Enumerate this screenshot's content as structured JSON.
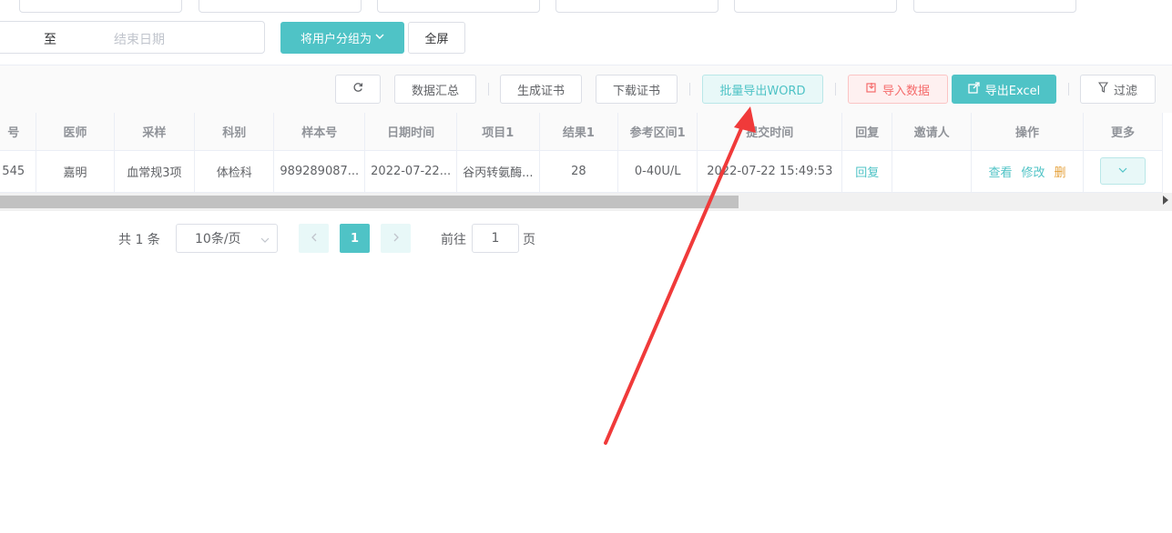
{
  "filters": {
    "date_sep": "至",
    "end_date_placeholder": "结束日期",
    "group_button": "将用户分组为",
    "fullscreen_button": "全屏"
  },
  "toolbar": {
    "summary": "数据汇总",
    "gen_cert": "生成证书",
    "download_cert": "下载证书",
    "export_word": "批量导出WORD",
    "import_data": "导入数据",
    "export_excel": "导出Excel",
    "filter": "过滤"
  },
  "table": {
    "headers": [
      "号",
      "医师",
      "采样",
      "科别",
      "样本号",
      "日期时间",
      "项目1",
      "结果1",
      "参考区间1",
      "提交时间",
      "回复",
      "邀请人",
      "操作",
      "更多"
    ],
    "rows": [
      {
        "id": "545",
        "doctor": "嘉明",
        "sample": "血常规3项",
        "dept": "体检科",
        "sample_no": "989289087...",
        "datetime": "2022-07-22...",
        "item1": "谷丙转氨酶...",
        "result1": "28",
        "ref1": "0-40U/L",
        "submit_time": "2022-07-22 15:49:53",
        "reply": "回复",
        "inviter": "",
        "op_view": "查看",
        "op_edit": "修改",
        "op_delete": "删"
      }
    ]
  },
  "pager": {
    "total": "共 1 条",
    "page_size": "10条/页",
    "current_page": "1",
    "goto_label": "前往",
    "goto_value": "1",
    "goto_suffix": "页"
  },
  "colors": {
    "accent": "#4fc3c6",
    "danger": "#f56c6c",
    "warning": "#e6a23c",
    "annotation_arrow": "#f03a3a"
  }
}
